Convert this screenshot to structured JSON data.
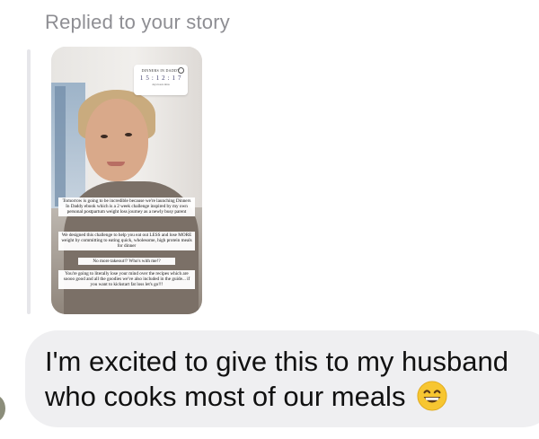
{
  "reply": {
    "header": "Replied to your story"
  },
  "story": {
    "countdown": {
      "title": "DINNERS IN DADDY",
      "digits": "1 5 : 1 2 : 1 7",
      "units": "days  hours  mins"
    },
    "captions": [
      "Tomorrow is going to be incredible because we're launching Dinners In Daddy ebook which is a 2 week challenge inspired by my own personal postpartum weight loss journey as a newly busy parent",
      "We designed this challenge to help you eat out LESS and lose MORE weight by committing to eating quick, wholesome, high protein meals for dinner",
      "No more takeout!? Who's with me!?",
      "You're going to literally lose your mind over the recipes which are soooo good and all the goodies we've also included in the guide... if you want to kickstart fat loss let's go!!!"
    ]
  },
  "message": {
    "text": "I'm excited to give this to my husband who cooks most of our meals",
    "emoji": "grinning-face-with-smiling-eyes"
  },
  "colors": {
    "bubble": "#efeff1",
    "header_text": "#8e8e93",
    "message_text": "#111111",
    "emoji": "#f7c631"
  }
}
